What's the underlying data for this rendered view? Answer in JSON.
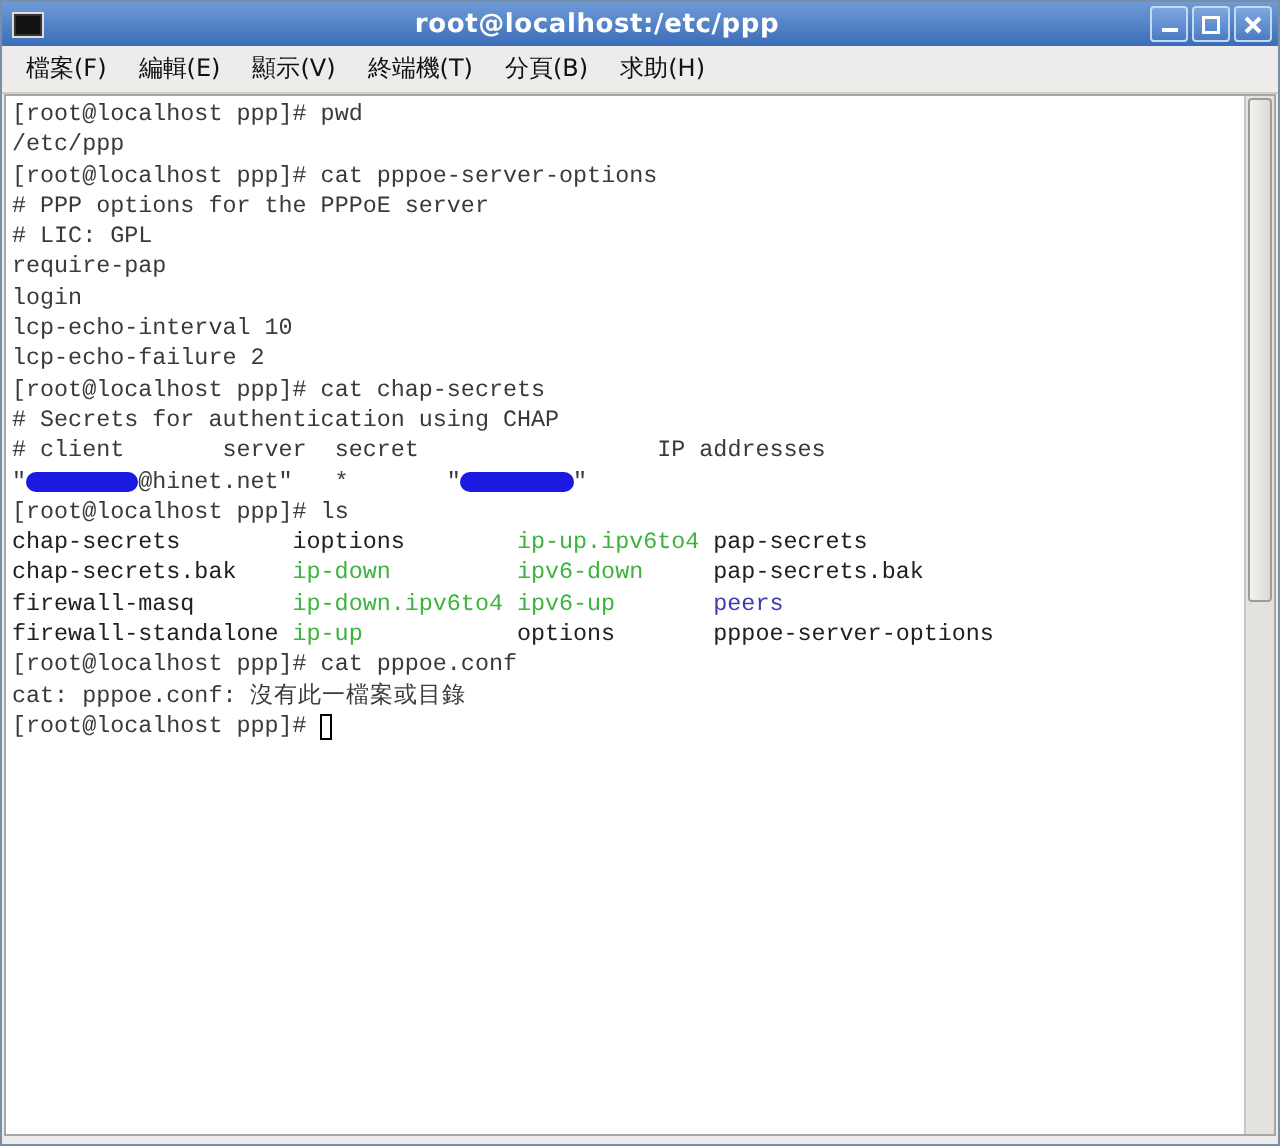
{
  "window": {
    "title": "root@localhost:/etc/ppp"
  },
  "menu": [
    "檔案(F)",
    "編輯(E)",
    "顯示(V)",
    "終端機(T)",
    "分頁(B)",
    "求助(H)"
  ],
  "terminal": {
    "lines": [
      {
        "kind": "text",
        "segments": [
          {
            "kind": "text",
            "text": "[root@localhost ppp]# pwd"
          }
        ]
      },
      {
        "kind": "text",
        "segments": [
          {
            "kind": "text",
            "text": "/etc/ppp"
          }
        ]
      },
      {
        "kind": "text",
        "segments": [
          {
            "kind": "text",
            "text": "[root@localhost ppp]# cat pppoe-server-options"
          }
        ]
      },
      {
        "kind": "text",
        "segments": [
          {
            "kind": "text",
            "text": "# PPP options for the PPPoE server"
          }
        ]
      },
      {
        "kind": "text",
        "segments": [
          {
            "kind": "text",
            "text": "# LIC: GPL"
          }
        ]
      },
      {
        "kind": "text",
        "segments": [
          {
            "kind": "text",
            "text": "require-pap"
          }
        ]
      },
      {
        "kind": "text",
        "segments": [
          {
            "kind": "text",
            "text": "login"
          }
        ]
      },
      {
        "kind": "text",
        "segments": [
          {
            "kind": "text",
            "text": "lcp-echo-interval 10"
          }
        ]
      },
      {
        "kind": "text",
        "segments": [
          {
            "kind": "text",
            "text": "lcp-echo-failure 2"
          }
        ]
      },
      {
        "kind": "text",
        "segments": [
          {
            "kind": "text",
            "text": "[root@localhost ppp]# cat chap-secrets"
          }
        ]
      },
      {
        "kind": "text",
        "segments": [
          {
            "kind": "text",
            "text": "# Secrets for authentication using CHAP"
          }
        ]
      },
      {
        "kind": "text",
        "segments": [
          {
            "kind": "text",
            "text": "# client       server  secret                 IP addresses"
          }
        ]
      },
      {
        "kind": "text",
        "segments": [
          {
            "kind": "text",
            "text": "\""
          },
          {
            "kind": "redaction"
          },
          {
            "kind": "text",
            "text": "@hinet.net\"   *       \""
          },
          {
            "kind": "redaction"
          },
          {
            "kind": "text",
            "text": "\""
          }
        ]
      },
      {
        "kind": "text",
        "segments": [
          {
            "kind": "text",
            "text": "[root@localhost ppp]# ls"
          }
        ]
      },
      {
        "kind": "listing",
        "cells": [
          {
            "text": "chap-secrets",
            "color": "#202020"
          },
          {
            "text": "ioptions",
            "color": "#202020"
          },
          {
            "text": "ip-up.ipv6to4",
            "color": "#3cb43c"
          },
          {
            "text": "pap-secrets",
            "color": "#202020"
          }
        ]
      },
      {
        "kind": "listing",
        "cells": [
          {
            "text": "chap-secrets.bak",
            "color": "#202020"
          },
          {
            "text": "ip-down",
            "color": "#3cb43c"
          },
          {
            "text": "ipv6-down",
            "color": "#3cb43c"
          },
          {
            "text": "pap-secrets.bak",
            "color": "#202020"
          }
        ]
      },
      {
        "kind": "listing",
        "cells": [
          {
            "text": "firewall-masq",
            "color": "#202020"
          },
          {
            "text": "ip-down.ipv6to4",
            "color": "#3cb43c"
          },
          {
            "text": "ipv6-up",
            "color": "#3cb43c"
          },
          {
            "text": "peers",
            "color": "#3c3cb4"
          }
        ]
      },
      {
        "kind": "listing",
        "cells": [
          {
            "text": "firewall-standalone",
            "color": "#202020"
          },
          {
            "text": "ip-up",
            "color": "#3cb43c"
          },
          {
            "text": "options",
            "color": "#202020"
          },
          {
            "text": "pppoe-server-options",
            "color": "#202020"
          }
        ]
      },
      {
        "kind": "text",
        "segments": [
          {
            "kind": "text",
            "text": "[root@localhost ppp]# cat pppoe.conf"
          }
        ]
      },
      {
        "kind": "text",
        "segments": [
          {
            "kind": "text",
            "text": "cat: pppoe.conf: 沒有此一檔案或目錄"
          }
        ]
      },
      {
        "kind": "text",
        "segments": [
          {
            "kind": "text",
            "text": "[root@localhost ppp]# "
          },
          {
            "kind": "cursor"
          }
        ]
      }
    ]
  }
}
